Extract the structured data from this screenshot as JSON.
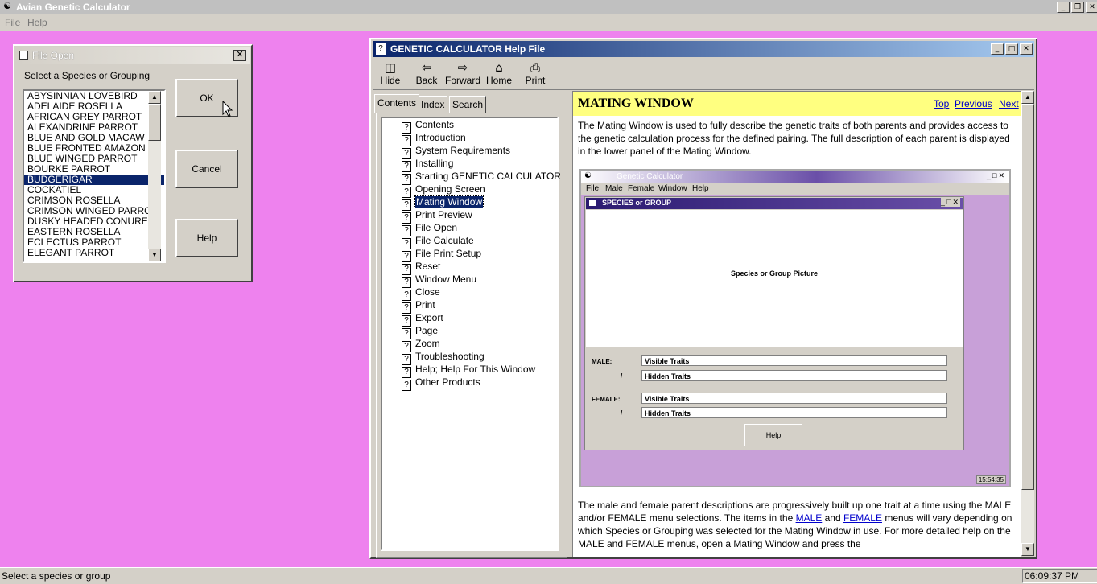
{
  "app": {
    "title": "Avian Genetic Calculator",
    "menu": [
      "File",
      "Help"
    ]
  },
  "status": {
    "text": "Select a species or group",
    "clock": "06:09:37 PM"
  },
  "dialog": {
    "title": "File Open",
    "label": "Select a Species or Grouping",
    "species": [
      "ABYSINNIAN LOVEBIRD",
      "ADELAIDE ROSELLA",
      "AFRICAN GREY PARROT",
      "ALEXANDRINE PARROT",
      "BLUE AND GOLD MACAW",
      "BLUE FRONTED AMAZON",
      "BLUE WINGED PARROT",
      "BOURKE PARROT",
      "BUDGERIGAR",
      "COCKATIEL",
      "CRIMSON ROSELLA",
      "CRIMSON WINGED PARROT",
      "DUSKY HEADED CONURE",
      "EASTERN ROSELLA",
      "ECLECTUS PARROT",
      "ELEGANT PARROT"
    ],
    "selected": "BUDGERIGAR",
    "ok_label": "OK",
    "cancel_label": "Cancel",
    "help_label": "Help"
  },
  "help": {
    "title": "GENETIC CALCULATOR Help File",
    "toolbar": {
      "hide": "Hide",
      "back": "Back",
      "forward": "Forward",
      "home": "Home",
      "print": "Print"
    },
    "tabs": [
      "Contents",
      "Index",
      "Search"
    ],
    "toc": [
      "Contents",
      "Introduction",
      "System Requirements",
      "Installing",
      "Starting GENETIC CALCULATOR",
      "Opening Screen",
      "Mating Window",
      "Print Preview",
      "File Open",
      "File Calculate",
      "File Print Setup",
      "Reset",
      "Window Menu",
      "Close",
      "Print",
      "Export",
      "Page",
      "Zoom",
      "Troubleshooting",
      "Help; Help For This Window",
      "Other Products"
    ],
    "toc_selected": "Mating Window",
    "topic": {
      "title": "MATING WINDOW",
      "nav_top": "Top",
      "nav_previous": "Previous",
      "nav_next": "Next",
      "para1": "The Mating Window is used to fully describe the genetic traits of both parents and provides access to  the genetic calculation process for the defined pairing. The full description of each parent is displayed in the lower panel of the Mating Window.",
      "para2_a": "The male and female parent descriptions are progressively built up one trait at a time using the MALE and/or FEMALE menu selections. The items in the ",
      "para2_link1": "MALE",
      "para2_b": " and ",
      "para2_link2": "FEMALE",
      "para2_c": " menus will vary depending on which Species or Grouping was selected for the Mating Window in use. For more detailed help on the MALE and FEMALE menus, open a Mating Window and press the"
    },
    "embed": {
      "title": "Genetic Calculator",
      "menu": [
        "File",
        "Male",
        "Female",
        "Window",
        "Help"
      ],
      "inner_title": "SPECIES or GROUP",
      "picture_label": "Species or Group Picture",
      "male_label": "MALE:",
      "female_label": "FEMALE:",
      "slash": "/",
      "visible_traits": "Visible Traits",
      "hidden_traits": "Hidden Traits",
      "help_label": "Help",
      "clock": "15:54:35"
    }
  }
}
